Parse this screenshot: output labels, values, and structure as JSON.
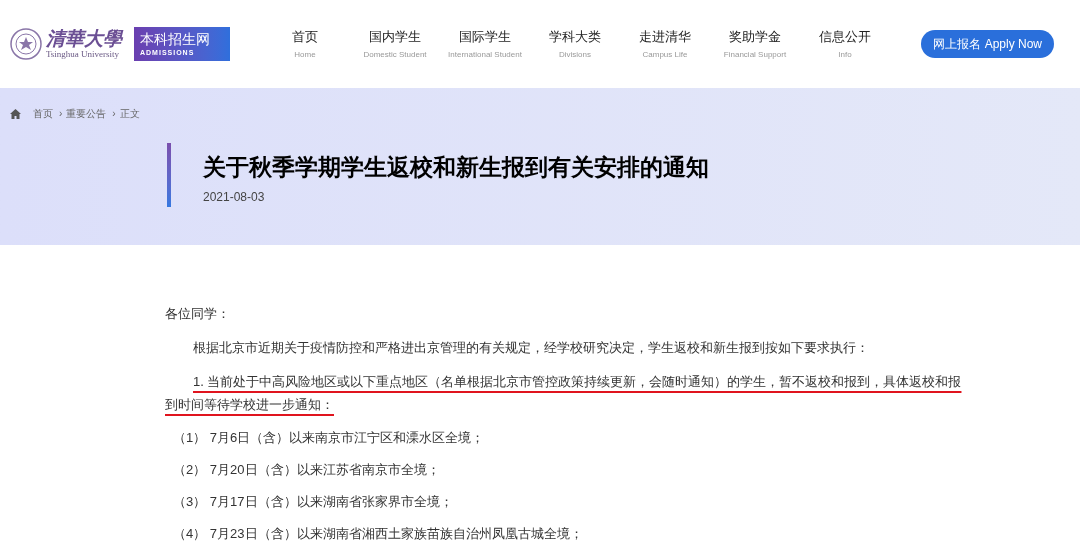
{
  "header": {
    "logo": {
      "name": "清華大學",
      "subtitle": "Tsinghua University"
    },
    "badge": {
      "title": "本科招生网",
      "subtitle": "ADMISSIONS"
    },
    "nav": [
      {
        "label": "首页",
        "sublabel": "Home"
      },
      {
        "label": "国内学生",
        "sublabel": "Domestic Student"
      },
      {
        "label": "国际学生",
        "sublabel": "International Student"
      },
      {
        "label": "学科大类",
        "sublabel": "Divisions"
      },
      {
        "label": "走进清华",
        "sublabel": "Campus Life"
      },
      {
        "label": "奖助学金",
        "sublabel": "Financial Support"
      },
      {
        "label": "信息公开",
        "sublabel": "Info"
      }
    ],
    "apply_button": "网上报名 Apply Now"
  },
  "banner": {
    "breadcrumb": [
      "首页",
      "重要公告",
      "正文"
    ],
    "separator": "›",
    "title": "关于秋季学期学生返校和新生报到有关安排的通知",
    "date": "2021-08-03"
  },
  "article": {
    "paragraphs": [
      {
        "kind": "greeting",
        "text": "各位同学：",
        "underlined": false
      },
      {
        "kind": "intro",
        "text": "根据北京市近期关于疫情防控和严格进出京管理的有关规定，经学校研究决定，学生返校和新生报到按如下要求执行：",
        "underlined": false
      },
      {
        "kind": "intro",
        "text": "1. 当前处于中高风险地区或以下重点地区（名单根据北京市管控政策持续更新，会随时通知）的学生，暂不返校和报到，具体返校和报到时间等待学校进一步通知：",
        "underlined": true
      },
      {
        "kind": "item",
        "text": "（1） 7月6日（含）以来南京市江宁区和溧水区全境；",
        "underlined": false
      },
      {
        "kind": "item",
        "text": "（2） 7月20日（含）以来江苏省南京市全境；",
        "underlined": false
      },
      {
        "kind": "item",
        "text": "（3） 7月17日（含）以来湖南省张家界市全境；",
        "underlined": false
      },
      {
        "kind": "item",
        "text": "（4） 7月23日（含）以来湖南省湘西土家族苗族自治州凤凰古城全境；",
        "underlined": false
      }
    ]
  }
}
